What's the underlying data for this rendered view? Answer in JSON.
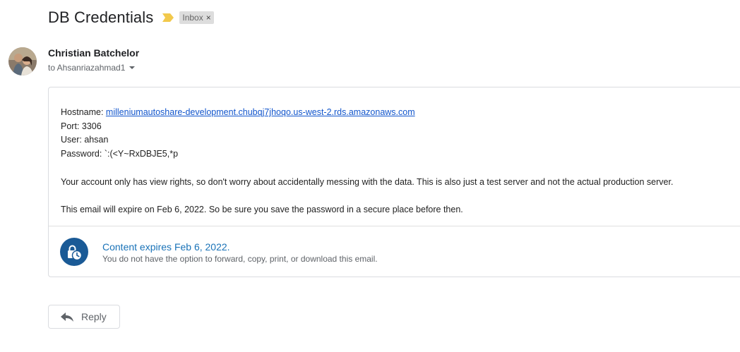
{
  "email": {
    "subject": "DB Credentials",
    "label": "Inbox",
    "label_close": "×",
    "sender": "Christian Batchelor",
    "to": "to Ahsanriazahmad1"
  },
  "body": {
    "hostname_label": "Hostname: ",
    "hostname": "milleniumautoshare-development.chubqj7jhoqo.us-west-2.rds.amazonaws.com",
    "port": "Port: 3306",
    "user": "User: ahsan",
    "password": "Password: `:(<Y~RxDBJE5,*p",
    "paragraph1": "Your account only has view rights, so don't worry about accidentally messing with the data. This is also just a test server and not the actual production server.",
    "paragraph2": "This email will expire on Feb 6, 2022. So be sure you save the password in a secure place before then."
  },
  "confidential": {
    "title": "Content expires Feb 6, 2022.",
    "subtitle": "You do not have the option to forward, copy, print, or download this email."
  },
  "actions": {
    "reply_label": "Reply"
  },
  "colors": {
    "link": "#1155cc",
    "accent": "#1a5a96",
    "importance": "#f2c94c"
  }
}
